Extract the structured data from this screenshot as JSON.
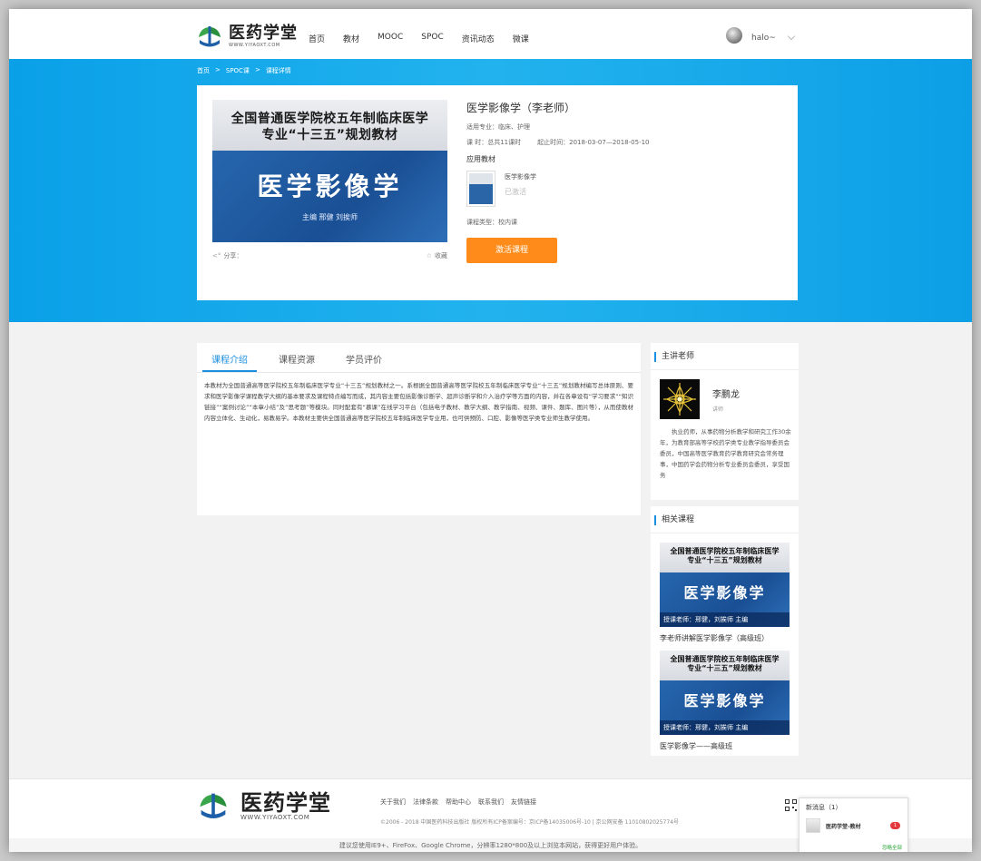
{
  "brand": {
    "name": "医药学堂",
    "domain": "WWW.YIYAOXT.COM"
  },
  "nav": [
    "首页",
    "教材",
    "MOOC",
    "SPOC",
    "资讯动态",
    "微课"
  ],
  "user": {
    "name": "halo~"
  },
  "breadcrumb": [
    "首页",
    ">",
    "SPOC课",
    ">",
    "课程详情"
  ],
  "course": {
    "cover_subtitle_line1": "全国普通医学院校五年制临床医学",
    "cover_subtitle_line2": "专业“十三五”规划教材",
    "cover_title": "医学影像学",
    "cover_editors": "主编   邢健   刘挨师",
    "share": "分享：",
    "favorite": "收藏",
    "title": "医学影像学（李老师）",
    "major": "适用专业：临床、护理",
    "hours": "课 时：总共11课时",
    "period": "起止时间：2018-03-07—2018-05-10",
    "textbook_label": "应用教材",
    "textbook_name": "医学影像学",
    "textbook_status": "已激活",
    "type": "课程类型：校内课",
    "activate_label": "激活课程"
  },
  "tabs": [
    {
      "label": "课程介绍",
      "active": true
    },
    {
      "label": "课程资源",
      "active": false
    },
    {
      "label": "学员评价",
      "active": false
    }
  ],
  "description": "本教材为全国普通高等医学院校五年制临床医学专业“十三五”规划教材之一。系根据全国普通高等医学院校五年制临床医学专业“十三五”规划教材编写总体原则、要求和医学影像学课程教学大纲的基本要求及课程特点编写而成，其内容主要包括影像诊断学、超声诊断学和介入治疗学等方面的内容，并在各章设有“学习要求”“知识链接”“案例讨论”“本章小结”及“思考题”等模块。同时配套有“慕课”在线学习平台（包括电子教材、教学大纲、教学指南、视频、课件、题库、图片等），从而使教材内容立体化、生动化，易教易学。本教材主要供全国普通高等医学院校五年制临床医学专业用，也可供预防、口腔、影像等医学类专业师生教学使用。",
  "teacher_section": {
    "heading": "主讲老师",
    "name": "李鹏龙",
    "role": "讲师",
    "bio": "执业药师，从事药物分析教学和研究工作30余年，为教育部高等学校药学类专业教学指导委员会委员，中国高等医学教育药学教育研究会常务理事，中国药学会药物分析专业委员会委员，享受国务"
  },
  "related_section": {
    "heading": "相关课程",
    "items": [
      {
        "cover_line1": "全国普通医学院校五年制临床医学",
        "cover_line2": "专业“十三五”规划教材",
        "cover_title": "医学影像学",
        "cover_bar": "授课老师：邢健，刘挨师 主编",
        "title": "李老师讲解医学影像学（高级班）"
      },
      {
        "cover_line1": "全国普通医学院校五年制临床医学",
        "cover_line2": "专业“十三五”规划教材",
        "cover_title": "医学影像学",
        "cover_bar": "授课老师：邢健，刘挨师 主编",
        "title": "医学影像学——高级班"
      }
    ]
  },
  "footer": {
    "links": [
      "关于我们",
      "法律条款",
      "帮助中心",
      "联系我们",
      "友情链接"
    ],
    "copyright": "©2006 - 2018 中国医药科技出版社 版权所有ICP备案编号：京ICP备14035006号-10 | 京公网安备 11010802025774号",
    "note": "建议您使用IE9+、FireFox、Google Chrome，分辨率1280*800及以上浏览本网站，获得更好用户体验。"
  },
  "message_box": {
    "title": "新消息（1）",
    "sender": "医药学堂-教材",
    "count": "1",
    "ignore": "忽略全部"
  },
  "colors": {
    "accent": "#1a8fe0",
    "hero": "#0aa0e8",
    "cta": "#ff8c1a"
  }
}
